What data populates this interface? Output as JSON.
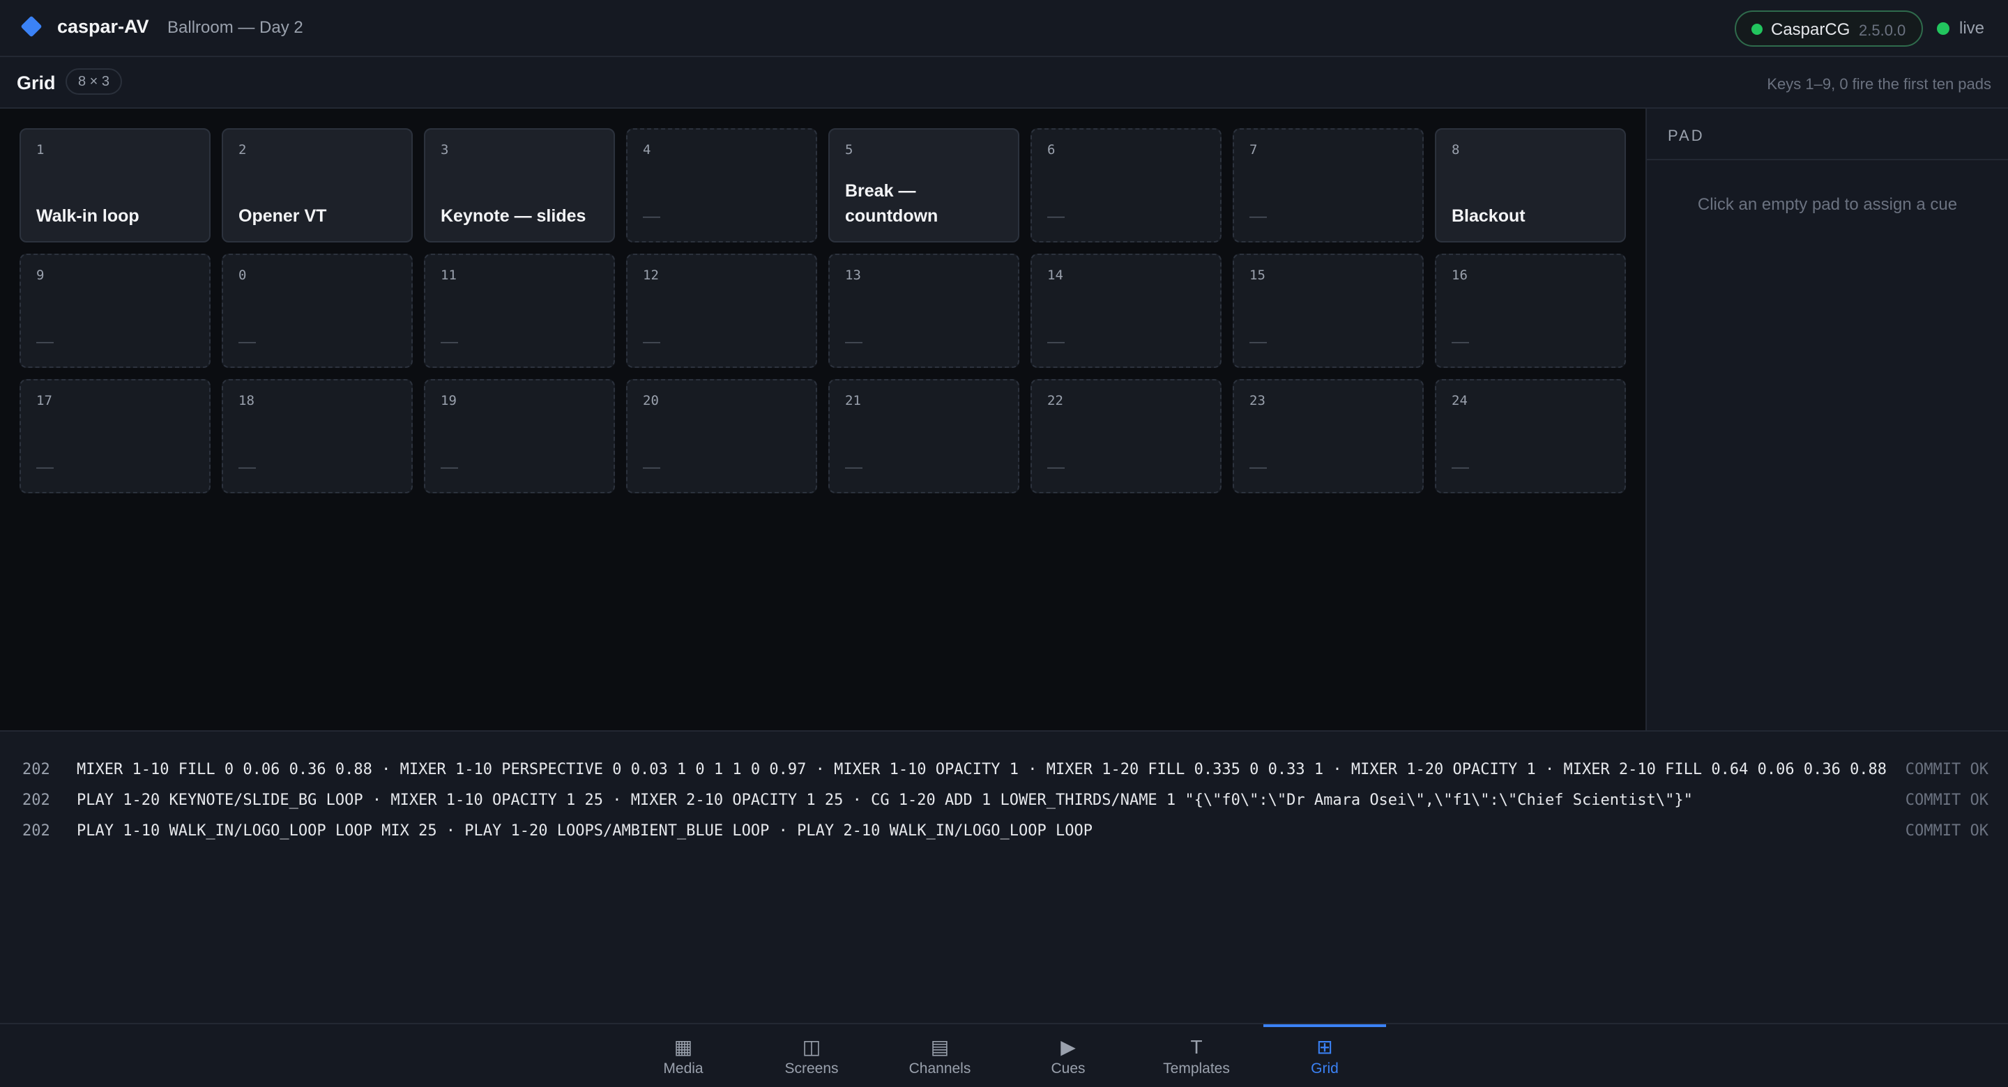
{
  "header": {
    "app_name": "caspar-AV",
    "project_name": "Ballroom — Day 2",
    "server": {
      "name": "CasparCG",
      "version": "2.5.0.0",
      "status_color": "#22c55e"
    },
    "live_label": "live",
    "accent_color": "#3b82f6"
  },
  "subbar": {
    "title": "Grid",
    "size": "8 × 3",
    "hint": "Keys 1–9, 0 fire the first ten pads"
  },
  "grid": {
    "pads": [
      {
        "num": "1",
        "label": "Walk-in loop",
        "state": "filled"
      },
      {
        "num": "2",
        "label": "Opener VT",
        "state": "filled"
      },
      {
        "num": "3",
        "label": "Keynote — slides",
        "state": "filled"
      },
      {
        "num": "4",
        "label": "—",
        "state": "empty"
      },
      {
        "num": "5",
        "label": "Break — countdown",
        "state": "filled"
      },
      {
        "num": "6",
        "label": "—",
        "state": "empty"
      },
      {
        "num": "7",
        "label": "—",
        "state": "empty"
      },
      {
        "num": "8",
        "label": "Blackout",
        "state": "filled"
      },
      {
        "num": "9",
        "label": "—",
        "state": "empty"
      },
      {
        "num": "0",
        "label": "—",
        "state": "empty"
      },
      {
        "num": "11",
        "label": "—",
        "state": "empty"
      },
      {
        "num": "12",
        "label": "—",
        "state": "empty"
      },
      {
        "num": "13",
        "label": "—",
        "state": "empty"
      },
      {
        "num": "14",
        "label": "—",
        "state": "empty"
      },
      {
        "num": "15",
        "label": "—",
        "state": "empty"
      },
      {
        "num": "16",
        "label": "—",
        "state": "empty"
      },
      {
        "num": "17",
        "label": "—",
        "state": "empty"
      },
      {
        "num": "18",
        "label": "—",
        "state": "empty"
      },
      {
        "num": "19",
        "label": "—",
        "state": "empty"
      },
      {
        "num": "20",
        "label": "—",
        "state": "empty"
      },
      {
        "num": "21",
        "label": "—",
        "state": "empty"
      },
      {
        "num": "22",
        "label": "—",
        "state": "empty"
      },
      {
        "num": "23",
        "label": "—",
        "state": "empty"
      },
      {
        "num": "24",
        "label": "—",
        "state": "empty"
      }
    ]
  },
  "pad_panel": {
    "title": "PAD",
    "empty_message": "Click an empty pad to assign a cue"
  },
  "log": [
    {
      "code": "202",
      "command": "MIXER 1-10 FILL 0 0.06 0.36 0.88 · MIXER 1-10 PERSPECTIVE 0 0.03 1 0 1 1 0 0.97 · MIXER 1-10 OPACITY 1 · MIXER 1-20 FILL 0.335 0 0.33 1 · MIXER 1-20 OPACITY 1 · MIXER 2-10 FILL 0.64 0.06 0.36 0.88",
      "status": "COMMIT OK"
    },
    {
      "code": "202",
      "command": "PLAY 1-20 KEYNOTE/SLIDE_BG LOOP · MIXER 1-10 OPACITY 1 25 · MIXER 2-10 OPACITY 1 25 · CG 1-20 ADD 1 LOWER_THIRDS/NAME 1 \"{\\\"f0\\\":\\\"Dr Amara Osei\\\",\\\"f1\\\":\\\"Chief Scientist\\\"}\"",
      "status": "COMMIT OK"
    },
    {
      "code": "202",
      "command": "PLAY 1-10 WALK_IN/LOGO_LOOP LOOP MIX 25 · PLAY 1-20 LOOPS/AMBIENT_BLUE LOOP · PLAY 2-10 WALK_IN/LOGO_LOOP LOOP",
      "status": "COMMIT OK"
    }
  ],
  "nav": {
    "items": [
      {
        "label": "Media",
        "icon": "media-icon",
        "glyph": "▦"
      },
      {
        "label": "Screens",
        "icon": "screens-icon",
        "glyph": "◫"
      },
      {
        "label": "Channels",
        "icon": "channels-icon",
        "glyph": "▤"
      },
      {
        "label": "Cues",
        "icon": "cues-icon",
        "glyph": "▶"
      },
      {
        "label": "Templates",
        "icon": "templates-icon",
        "glyph": "T"
      },
      {
        "label": "Grid",
        "icon": "grid-icon",
        "glyph": "⊞"
      }
    ],
    "active": "Grid"
  }
}
